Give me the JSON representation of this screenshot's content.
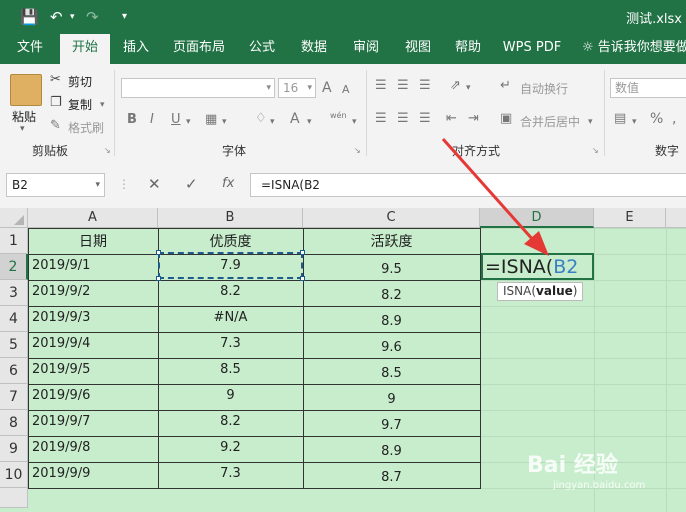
{
  "titlebar": {
    "filename": "测试.xlsx",
    "icons": [
      "save-icon",
      "undo-icon",
      "undo-dropdown-icon",
      "redo-icon",
      "customize-qat-icon"
    ]
  },
  "tabs": [
    "文件",
    "开始",
    "插入",
    "页面布局",
    "公式",
    "数据",
    "审阅",
    "视图",
    "帮助",
    "WPS PDF"
  ],
  "active_tab": "开始",
  "tell_me": "告诉我你想要做",
  "ribbon": {
    "clipboard": {
      "paste": "粘贴",
      "cut": "剪切",
      "copy": "复制",
      "format_painter": "格式刷",
      "label": "剪贴板"
    },
    "font": {
      "font_size": "16",
      "label": "字体",
      "bold": "B",
      "italic": "I",
      "underline": "U",
      "grow": "A",
      "shrink": "A",
      "phonetic": "wén"
    },
    "alignment": {
      "wrap_text": "自动换行",
      "merge_center": "合并后居中",
      "label": "对齐方式"
    },
    "number": {
      "format": "数值",
      "percent": "%",
      "label": "数字"
    }
  },
  "formula_bar": {
    "name_box": "B2",
    "cancel": "✕",
    "enter": "✓",
    "fx": "fx",
    "formula": "=ISNA(B2"
  },
  "sheet": {
    "columns": [
      "A",
      "B",
      "C",
      "D",
      "E"
    ],
    "rows": [
      "1",
      "2",
      "3",
      "4",
      "5",
      "6",
      "7",
      "8",
      "9",
      "10"
    ],
    "headers": [
      "日期",
      "优质度",
      "活跃度"
    ],
    "data": [
      [
        "2019/9/1",
        "7.9",
        "9.5"
      ],
      [
        "2019/9/2",
        "8.2",
        "8.2"
      ],
      [
        "2019/9/3",
        "#N/A",
        "8.9"
      ],
      [
        "2019/9/4",
        "7.3",
        "9.6"
      ],
      [
        "2019/9/5",
        "8.5",
        "8.5"
      ],
      [
        "2019/9/6",
        "9",
        "9"
      ],
      [
        "2019/9/7",
        "8.2",
        "9.7"
      ],
      [
        "2019/9/8",
        "9.2",
        "8.9"
      ],
      [
        "2019/9/9",
        "7.3",
        "8.7"
      ]
    ],
    "editing_prefix": "=ISNA(",
    "editing_ref": "B2",
    "tooltip_fn": "ISNA(",
    "tooltip_arg": "value",
    "tooltip_close": ")"
  },
  "watermark": {
    "main": "Bai 经验",
    "sub": "jingyan.baidu.com"
  },
  "accent_color": "#217346",
  "arrow_color": "#e53935"
}
